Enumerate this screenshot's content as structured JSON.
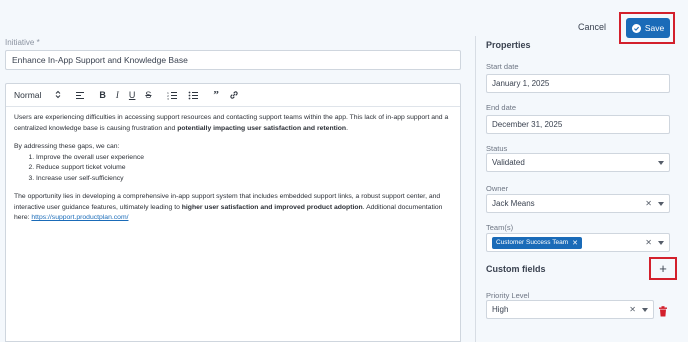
{
  "header": {
    "cancel_label": "Cancel",
    "save_label": "Save"
  },
  "initiative": {
    "label": "Initiative *",
    "value": "Enhance In-App Support and Knowledge Base"
  },
  "editor": {
    "toolbar": {
      "style_select": "Normal",
      "icons": [
        "align-left-icon",
        "bold-icon",
        "italic-icon",
        "underline-icon",
        "strikethrough-icon",
        "ordered-list-icon",
        "bullet-list-icon",
        "quote-icon",
        "link-icon"
      ]
    },
    "p1_plain": "Users are experiencing difficulties in accessing support resources and contacting support teams within the app. This lack of in-app support and a centralized knowledge base is causing frustration and ",
    "p1_bold": "potentially impacting user satisfaction and retention",
    "p1_end": ".",
    "p2": "By addressing these gaps, we can:",
    "list": [
      "Improve the overall user experience",
      "Reduce support ticket volume",
      "Increase user self-sufficiency"
    ],
    "p3_plain": "The opportunity lies in developing a comprehensive in-app support system that includes embedded support links, a robust support center, and interactive user guidance features, ultimately leading to ",
    "p3_bold": "higher user satisfaction and improved product adoption",
    "p3_mid": ". Additional documentation here: ",
    "p3_link": "https://support.productplan.com/"
  },
  "properties": {
    "title": "Properties",
    "start_date": {
      "label": "Start date",
      "value": "January 1, 2025"
    },
    "end_date": {
      "label": "End date",
      "value": "December 31, 2025"
    },
    "status": {
      "label": "Status",
      "value": "Validated"
    },
    "owner": {
      "label": "Owner",
      "value": "Jack Means"
    },
    "teams": {
      "label": "Team(s)",
      "chip": "Customer Success Team"
    }
  },
  "custom_fields": {
    "title": "Custom fields",
    "add_label": "+",
    "priority": {
      "label": "Priority Level",
      "value": "High"
    }
  },
  "colors": {
    "accent": "#1a6bb8",
    "highlight": "#d3202c",
    "delete": "#d3202c"
  }
}
